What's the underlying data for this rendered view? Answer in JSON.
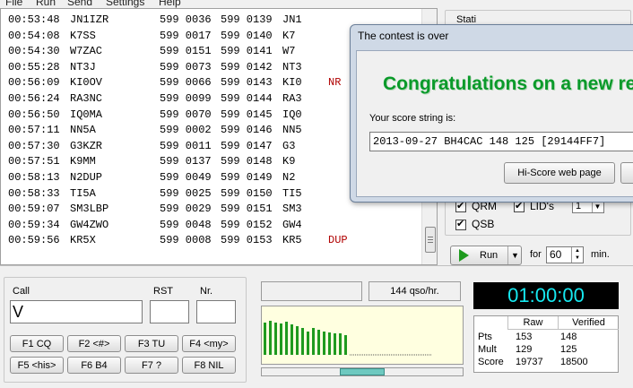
{
  "menu": [
    "File",
    "Run",
    "Send",
    "Settings",
    "Help"
  ],
  "log": [
    {
      "time": "00:53:48",
      "call": "JN1IZR",
      "sent": "599 0036",
      "recv": "599 0139",
      "prefix": "JN1",
      "err": ""
    },
    {
      "time": "00:54:08",
      "call": "K7SS",
      "sent": "599 0017",
      "recv": "599 0140",
      "prefix": "K7",
      "err": ""
    },
    {
      "time": "00:54:30",
      "call": "W7ZAC",
      "sent": "599 0151",
      "recv": "599 0141",
      "prefix": "W7",
      "err": ""
    },
    {
      "time": "00:55:28",
      "call": "NT3J",
      "sent": "599 0073",
      "recv": "599 0142",
      "prefix": "NT3",
      "err": ""
    },
    {
      "time": "00:56:09",
      "call": "KI0OV",
      "sent": "599 0066",
      "recv": "599 0143",
      "prefix": "KI0",
      "err": "NR"
    },
    {
      "time": "00:56:24",
      "call": "RA3NC",
      "sent": "599 0099",
      "recv": "599 0144",
      "prefix": "RA3",
      "err": ""
    },
    {
      "time": "00:56:50",
      "call": "IQ0MA",
      "sent": "599 0070",
      "recv": "599 0145",
      "prefix": "IQ0",
      "err": ""
    },
    {
      "time": "00:57:11",
      "call": "NN5A",
      "sent": "599 0002",
      "recv": "599 0146",
      "prefix": "NN5",
      "err": ""
    },
    {
      "time": "00:57:30",
      "call": "G3KZR",
      "sent": "599 0011",
      "recv": "599 0147",
      "prefix": "G3",
      "err": ""
    },
    {
      "time": "00:57:51",
      "call": "K9MM",
      "sent": "599 0137",
      "recv": "599 0148",
      "prefix": "K9",
      "err": ""
    },
    {
      "time": "00:58:13",
      "call": "N2DUP",
      "sent": "599 0049",
      "recv": "599 0149",
      "prefix": "N2",
      "err": ""
    },
    {
      "time": "00:58:33",
      "call": "TI5A",
      "sent": "599 0025",
      "recv": "599 0150",
      "prefix": "TI5",
      "err": ""
    },
    {
      "time": "00:59:07",
      "call": "SM3LBP",
      "sent": "599 0029",
      "recv": "599 0151",
      "prefix": "SM3",
      "err": ""
    },
    {
      "time": "00:59:34",
      "call": "GW4ZWO",
      "sent": "599 0048",
      "recv": "599 0152",
      "prefix": "GW4",
      "err": ""
    },
    {
      "time": "00:59:56",
      "call": "KR5X",
      "sent": "599 0008",
      "recv": "599 0153",
      "prefix": "KR5",
      "err": "DUP"
    }
  ],
  "conditions": {
    "group_label": "Stati",
    "qrm_label": "QRM",
    "lids_label": "LID's",
    "qsb_label": "QSB",
    "lids_spin_value": "1"
  },
  "run": {
    "label": "Run",
    "for_label": "for",
    "minutes": "60",
    "min_label": "min."
  },
  "entry": {
    "call_label": "Call",
    "call_value": "V",
    "rst_label": "RST",
    "rst_value": "",
    "nr_label": "Nr.",
    "nr_value": ""
  },
  "fkeys": [
    "F1 CQ",
    "F2 <#>",
    "F3 TU",
    "F4 <my>",
    "F5 <his>",
    "F6 B4",
    "F7 ?",
    "F8 NIL"
  ],
  "rate": {
    "text": "144 qso/hr."
  },
  "clock": "01:00:00",
  "score": {
    "headers": [
      "Raw",
      "Verified"
    ],
    "rows": [
      {
        "label": "Pts",
        "raw": "153",
        "verified": "148"
      },
      {
        "label": "Mult",
        "raw": "129",
        "verified": "125"
      },
      {
        "label": "Score",
        "raw": "19737",
        "verified": "18500"
      }
    ]
  },
  "dialog": {
    "title": "The contest is over",
    "congrats": "Congratulations on a new re",
    "score_label": "Your score string is:",
    "score_string": "2013-09-27 BH4CAC 148 125 [29144FF7]",
    "hiscore_button": "Hi-Score web page"
  },
  "colors": {
    "accent_green": "#0a9a2a",
    "clock_text": "#16e8f0",
    "error_red": "#b00000",
    "chart_bg": "#ffffe0",
    "bar_green": "#1f9a1f"
  },
  "chart_data": {
    "type": "bar",
    "values": [
      36,
      38,
      36,
      35,
      37,
      34,
      32,
      30,
      26,
      30,
      28,
      26,
      25,
      24,
      24,
      22
    ],
    "baseline_dotted": true
  }
}
